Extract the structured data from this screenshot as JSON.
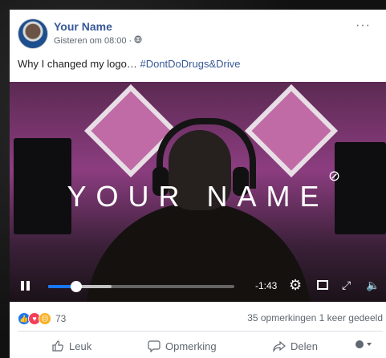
{
  "post": {
    "author": "Your Name",
    "timestamp": "Gisteren om 08:00 ·",
    "visibility_icon": "globe-icon",
    "text_main": "Why I changed my logo… ",
    "text_hashtag": "#DontDoDrugs&Drive"
  },
  "video": {
    "wordmark": "YOUR NAME",
    "wordmark_symbol": "⊘",
    "time_remaining": "-1:43",
    "progress": 0.15,
    "buffered": 0.34
  },
  "stats": {
    "reaction_count": "73",
    "comments_shares": "35 opmerkingen  1 keer gedeeld"
  },
  "actions": {
    "like": "Leuk",
    "comment": "Opmerking",
    "share": "Delen"
  },
  "colors": {
    "link": "#385898",
    "accent": "#1877f2"
  }
}
